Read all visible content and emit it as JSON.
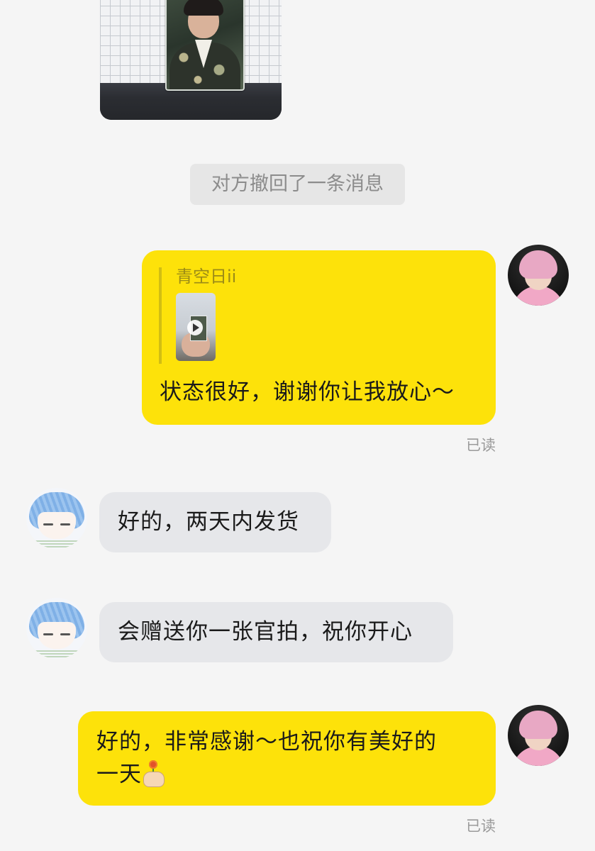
{
  "recall_notice": "对方撤回了一条消息",
  "messages": [
    {
      "sender": "me",
      "quote": {
        "name": "青空日ii"
      },
      "text": "状态很好，谢谢你让我放心～",
      "status": "已读"
    },
    {
      "sender": "other",
      "text": "好的，两天内发货"
    },
    {
      "sender": "other",
      "text": "会赠送你一张官拍，祝你开心"
    },
    {
      "sender": "me",
      "text_line1": "好的，非常感谢～也祝你有美好的",
      "text_line2": "一天",
      "emoji": "flower-in-hand-emoji",
      "status": "已读"
    }
  ],
  "colors": {
    "background": "#f5f5f5",
    "my_bubble": "#fde20a",
    "other_bubble": "#e6e7ea",
    "notice_bg": "#e6e6e6"
  }
}
